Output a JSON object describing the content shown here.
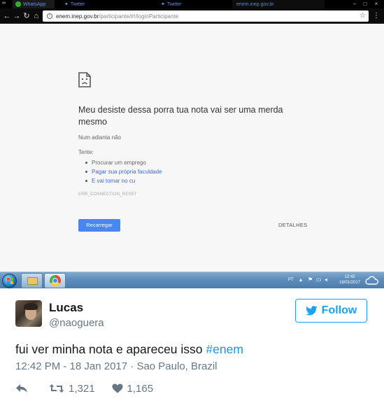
{
  "browser": {
    "tabs": [
      {
        "label": "WhatsApp"
      },
      {
        "label": "Twitter"
      },
      {
        "label": "Twitter"
      },
      {
        "label": "enem.inep.gov.br"
      }
    ],
    "url_host": "enem.inep.gov.br",
    "url_path": "/participante/#!/loginParticipante"
  },
  "error_page": {
    "title": "Meu desiste dessa porra tua nota vai ser uma merda mesmo",
    "subtitle": "Num adianta não",
    "try_label": "Tente:",
    "suggestions": [
      "Procurar um emprego",
      "Pagar sua própria faculdade",
      "E vai tomar no cu"
    ],
    "error_code": "ERR_CONNECTION_RESET",
    "reload_label": "Recarregar",
    "details_label": "DETALHES"
  },
  "taskbar": {
    "language": "PT",
    "time": "12:42",
    "date": "18/01/2017"
  },
  "tweet": {
    "display_name": "Lucas",
    "handle": "@naoguera",
    "follow_label": "Follow",
    "text": "fui ver minha nota e apareceu isso ",
    "hashtag": "#enem",
    "meta": "12:42 PM - 18 Jan 2017 · Sao Paulo, Brazil",
    "retweets": "1,321",
    "likes": "1,165"
  },
  "colors": {
    "twitter_blue": "#1da1f2",
    "link_blue": "#1b95e0",
    "chrome_button_blue": "#4a86f0"
  }
}
